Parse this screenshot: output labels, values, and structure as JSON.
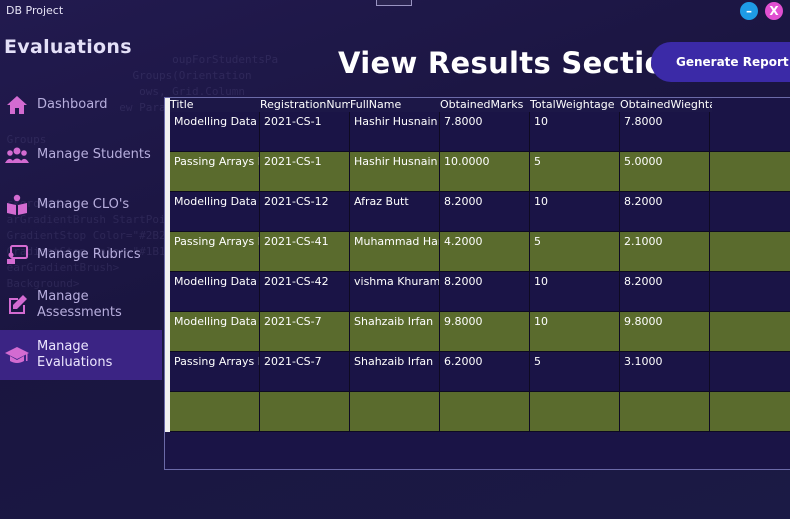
{
  "window": {
    "title": "DB Project",
    "min_label": "–",
    "close_label": "X"
  },
  "sidebar": {
    "title": "Evaluations",
    "items": [
      {
        "label": "Dashboard",
        "icon": "home-icon"
      },
      {
        "label": "Manage Students",
        "icon": "users-icon"
      },
      {
        "label": "Manage CLO's",
        "icon": "book-icon"
      },
      {
        "label": "Manage Rubrics",
        "icon": "rubric-icon"
      },
      {
        "label": "Manage Assessments",
        "icon": "edit-icon"
      },
      {
        "label": "Manage Evaluations",
        "icon": "graduation-cap-icon",
        "active": true
      }
    ]
  },
  "main": {
    "heading": "View Results Section",
    "generate_button": "Generate Report"
  },
  "grid": {
    "columns": [
      "Title",
      "RegistrationNumber",
      "FullName",
      "ObtainedMarks",
      "TotalWeightage",
      "ObtainedWieghtage"
    ],
    "rows": [
      [
        "Modelling Data",
        "2021-CS-1",
        "Hashir Husnain",
        "7.8000",
        "10",
        "7.8000"
      ],
      [
        "Passing Arrays Example",
        "2021-CS-1",
        "Hashir Husnain",
        "10.0000",
        "5",
        "5.0000"
      ],
      [
        "Modelling Data",
        "2021-CS-12",
        "Afraz Butt",
        "8.2000",
        "10",
        "8.2000"
      ],
      [
        "Passing Arrays Example",
        "2021-CS-41",
        "Muhammad Haris",
        "4.2000",
        "5",
        "2.1000"
      ],
      [
        "Modelling Data",
        "2021-CS-42",
        "vishma Khuram",
        "8.2000",
        "10",
        "8.2000"
      ],
      [
        "Modelling Data",
        "2021-CS-7",
        "Shahzaib Irfan",
        "9.8000",
        "10",
        "9.8000"
      ],
      [
        "Passing Arrays Example",
        "2021-CS-7",
        "Shahzaib Irfan",
        "6.2000",
        "5",
        "3.1000"
      ],
      [
        "",
        "",
        "",
        "",
        "",
        ""
      ]
    ]
  }
}
